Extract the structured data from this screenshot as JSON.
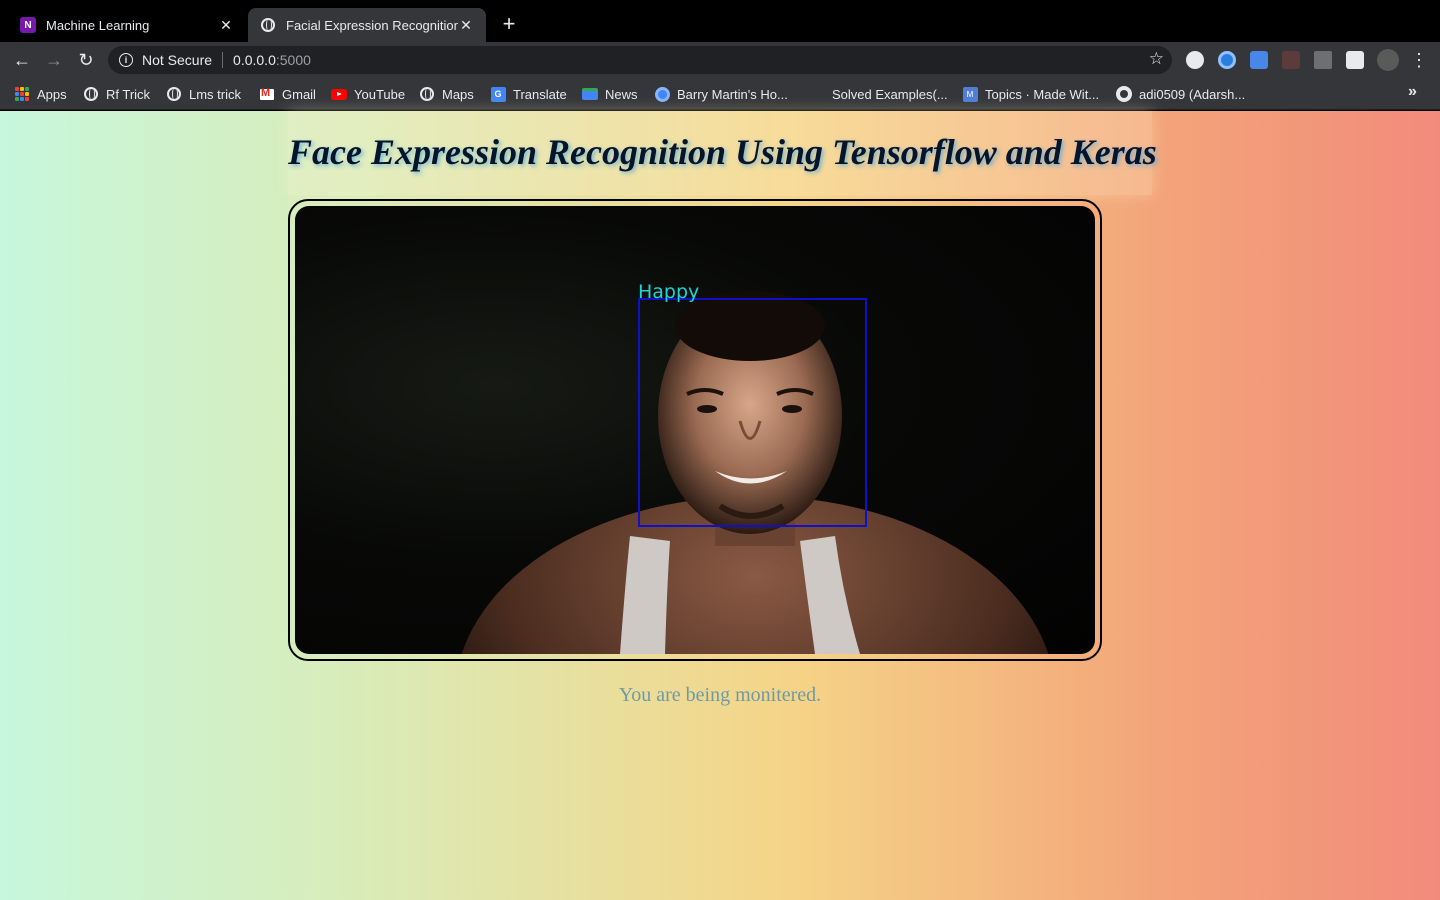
{
  "browser": {
    "tabs": [
      {
        "title": "Machine Learning",
        "icon": "onenote-icon",
        "active": false
      },
      {
        "title": "Facial Expression Recognition",
        "icon": "globe-icon",
        "active": true
      }
    ],
    "address_bar": {
      "security_label": "Not Secure",
      "host": "0.0.0.0",
      "port": ":5000"
    },
    "bookmarks": [
      {
        "label": "Apps",
        "icon": "apps-grid-icon"
      },
      {
        "label": "Rf Trick",
        "icon": "globe-icon"
      },
      {
        "label": "Lms trick",
        "icon": "globe-icon"
      },
      {
        "label": "Gmail",
        "icon": "gmail-icon"
      },
      {
        "label": "YouTube",
        "icon": "youtube-icon"
      },
      {
        "label": "Maps",
        "icon": "globe-icon"
      },
      {
        "label": "Translate",
        "icon": "translate-icon"
      },
      {
        "label": "News",
        "icon": "news-icon"
      },
      {
        "label": "Barry Martin's Ho...",
        "icon": "google-cloud-icon"
      },
      {
        "label": "Solved Examples(...",
        "icon": "none"
      },
      {
        "label": "Topics · Made Wit...",
        "icon": "topics-icon"
      },
      {
        "label": "adi0509 (Adarsh...",
        "icon": "github-icon"
      }
    ]
  },
  "page": {
    "heading": "Face Expression Recognition Using Tensorflow and Keras",
    "detection_label": "Happy",
    "status_text": "You are being monitered."
  },
  "colors": {
    "detection_box": "#1010c8",
    "detection_label": "#1ed3d8",
    "heading_text": "#06152b",
    "status_text": "#6e9aa6"
  }
}
